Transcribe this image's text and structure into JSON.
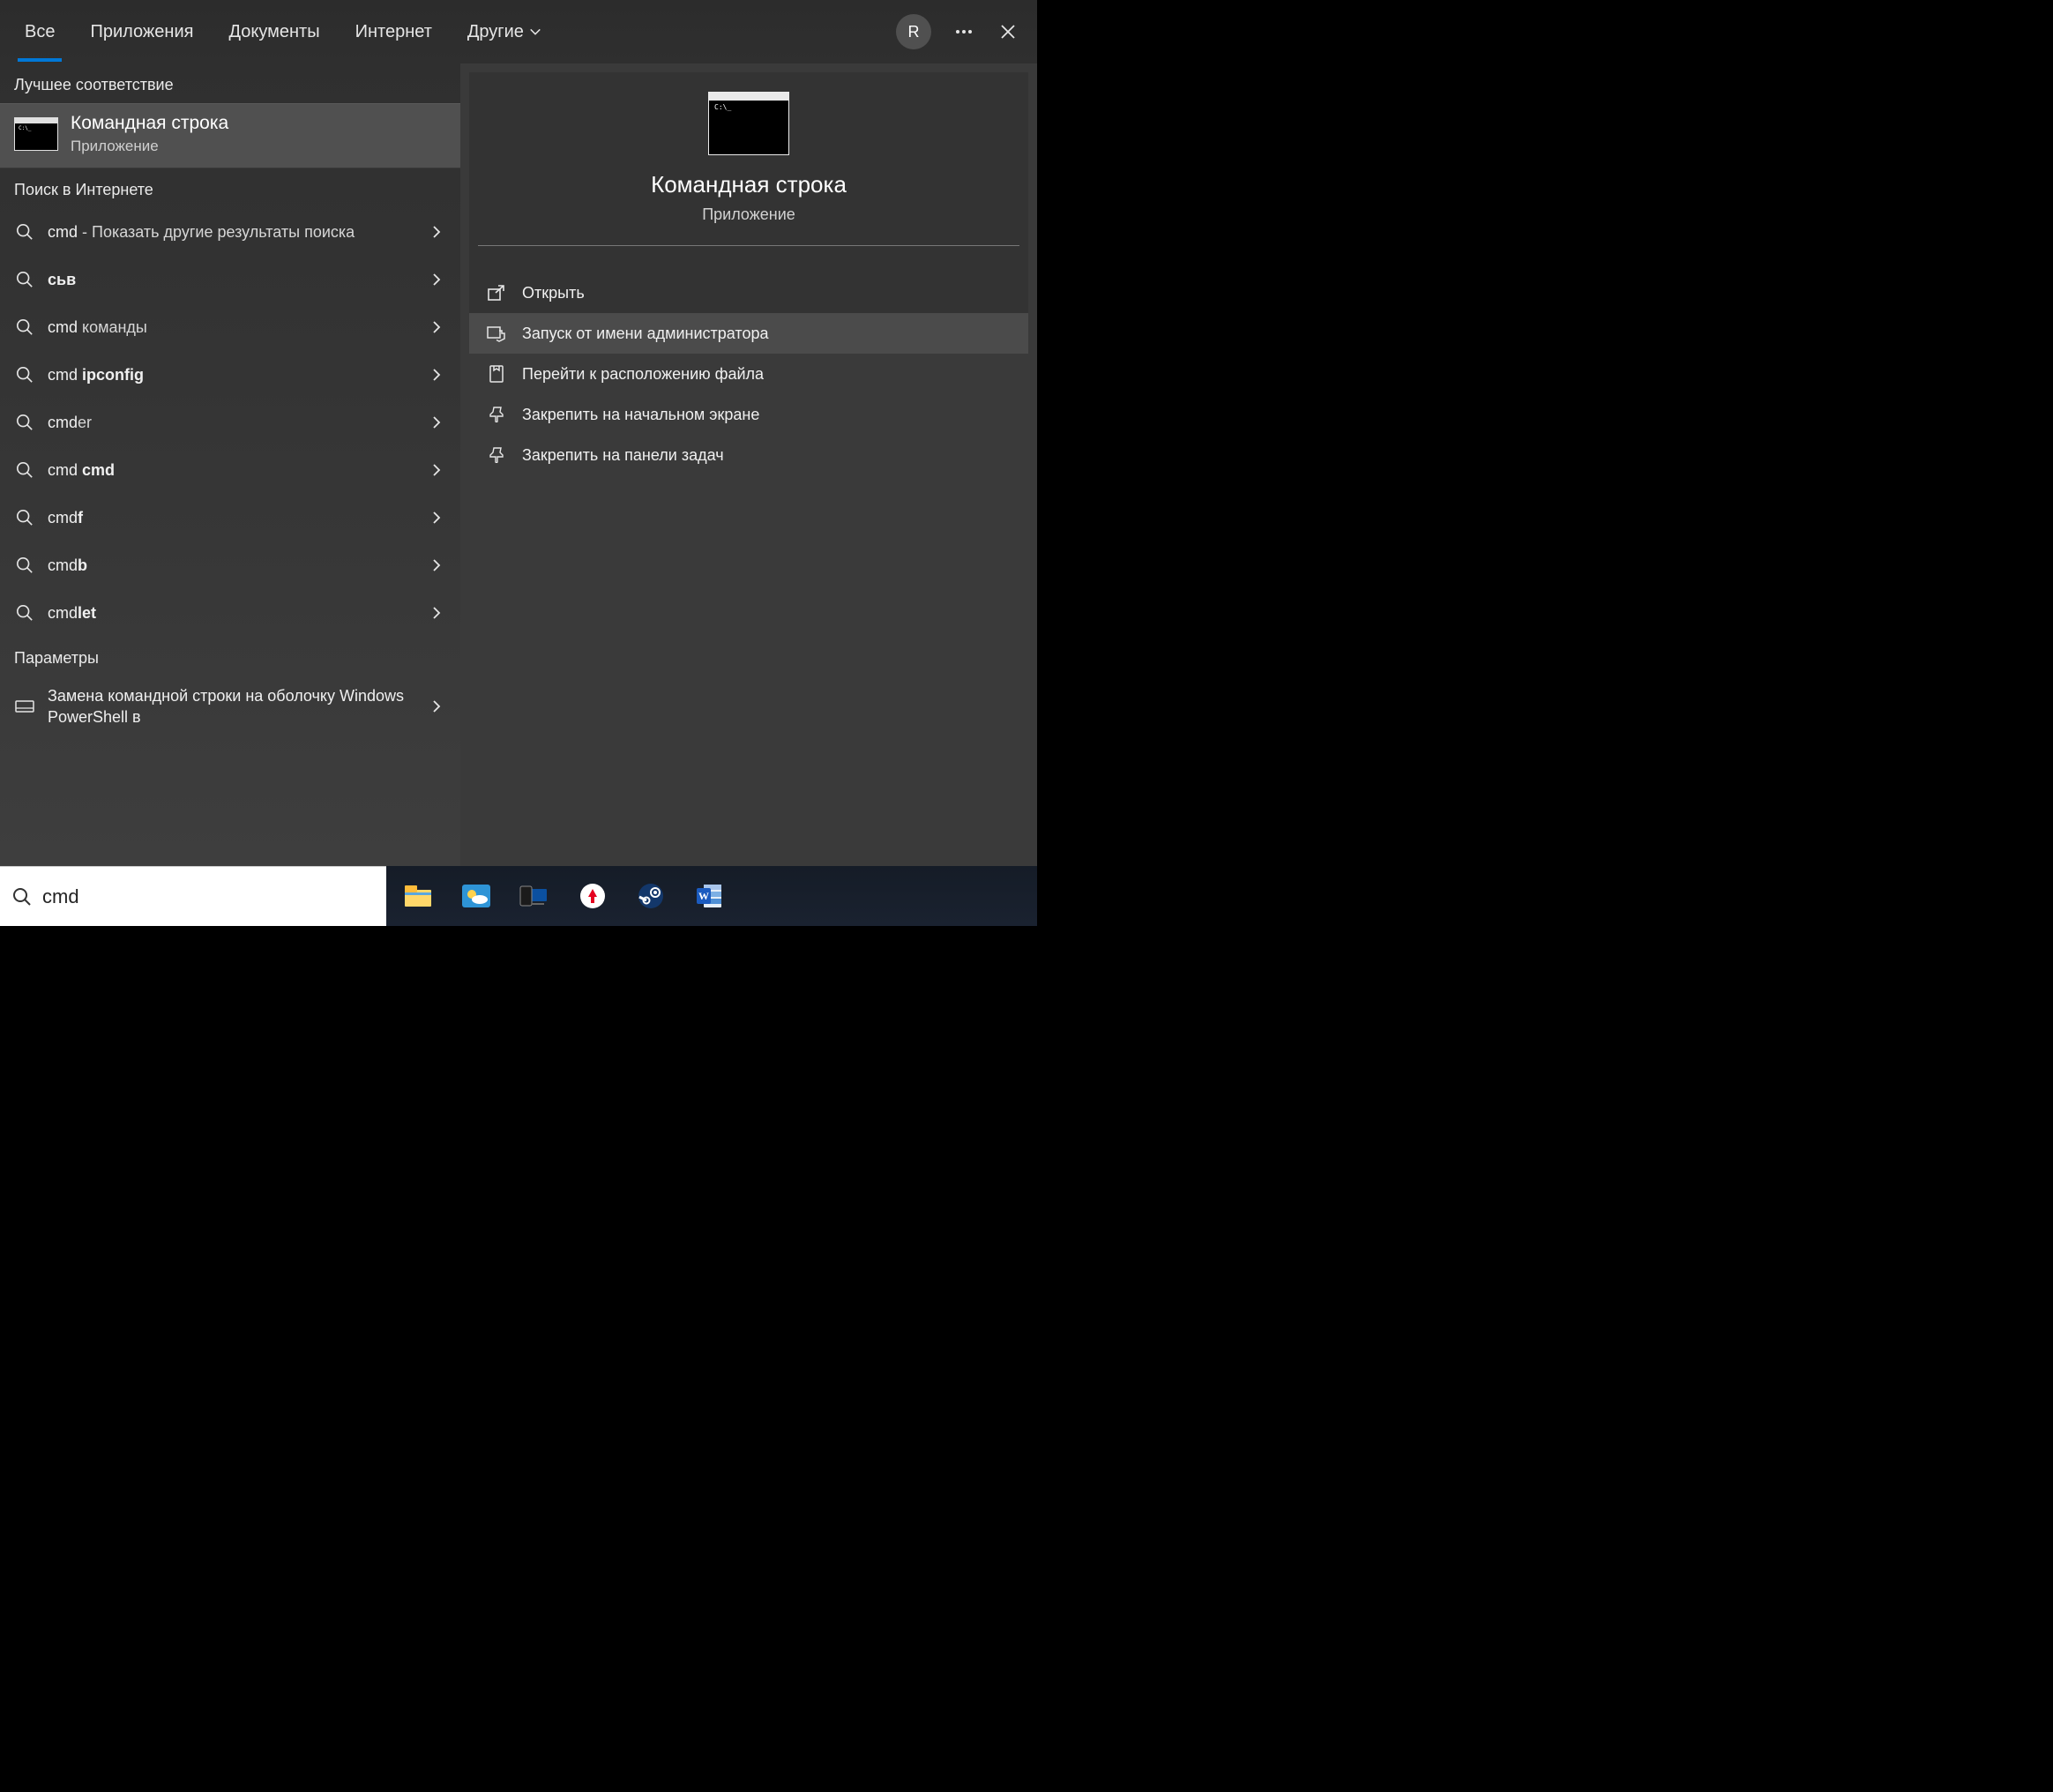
{
  "tabs": {
    "all": "Все",
    "apps": "Приложения",
    "docs": "Документы",
    "internet": "Интернет",
    "other": "Другие"
  },
  "user_initial": "R",
  "sections": {
    "best_match": "Лучшее соответствие",
    "web_search": "Поиск в Интернете",
    "settings": "Параметры"
  },
  "best_match": {
    "title": "Командная строка",
    "subtitle": "Приложение"
  },
  "web_results": [
    {
      "prefix": "cmd",
      "plain": " - ",
      "light": "Показать другие результаты поиска"
    },
    {
      "bold": "сьв"
    },
    {
      "prefix": "cmd ",
      "light": "команды"
    },
    {
      "prefix": "cmd ",
      "bold": "ipconfig"
    },
    {
      "prefix": "cmd",
      "light": "er"
    },
    {
      "prefix": "cmd ",
      "bold": "cmd"
    },
    {
      "prefix": "cmd",
      "bold": "f"
    },
    {
      "prefix": "cmd",
      "bold": "b"
    },
    {
      "prefix": "cmd",
      "bold": "let"
    }
  ],
  "settings_item": "Замена командной строки на оболочку Windows PowerShell в",
  "preview": {
    "title": "Командная строка",
    "subtitle": "Приложение",
    "actions": [
      {
        "id": "open",
        "label": "Открыть"
      },
      {
        "id": "runas",
        "label": "Запуск от имени администратора"
      },
      {
        "id": "location",
        "label": "Перейти к расположению файла"
      },
      {
        "id": "pin-start",
        "label": "Закрепить на начальном экране"
      },
      {
        "id": "pin-taskbar",
        "label": "Закрепить на панели задач"
      }
    ]
  },
  "taskbar": {
    "search_value": "cmd",
    "icons": [
      "explorer",
      "weather",
      "yourphone",
      "yandex",
      "steam",
      "word"
    ]
  }
}
